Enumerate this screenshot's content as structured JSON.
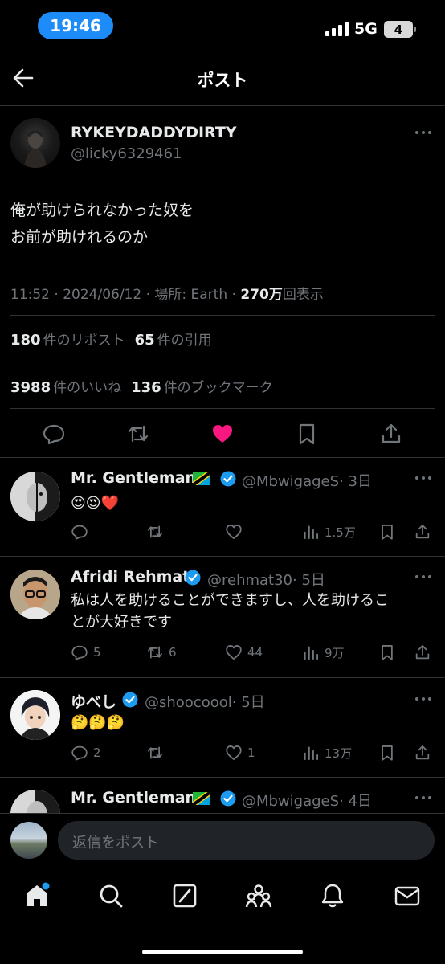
{
  "status_bar": {
    "time": "19:46",
    "network": "5G",
    "battery": "4"
  },
  "header": {
    "title": "ポスト"
  },
  "post": {
    "author_name": "RYKEYDADDYDIRTY",
    "author_handle": "@licky6329461",
    "text_line1": "俺が助けられなかった奴を",
    "text_line2": "お前が助けれるのか",
    "time_date": "11:52 · 2024/06/12 · 場所: Earth ·",
    "views_count": "270万",
    "views_label": "回表示",
    "reposts_count": "180",
    "reposts_label": "件のリポスト",
    "quotes_count": "65",
    "quotes_label": "件の引用",
    "likes_count": "3988",
    "likes_label": "件のいいね",
    "bookmarks_count": "136",
    "bookmarks_label": "件のブックマーク",
    "liked": true,
    "like_color": "#f91880"
  },
  "replies": [
    {
      "name": "Mr. Gentleman",
      "handle": "@MbwigageS",
      "age": "· 3日",
      "text": "😍😍❤️",
      "reply_count": "",
      "repost_count": "",
      "like_count": "",
      "view_count": "1.5万"
    },
    {
      "name": "Afridi Rehmat",
      "handle": "@rehmat30",
      "age": "· 5日",
      "text_line1": "私は人を助けることができますし、人を助けるこ",
      "text_line2": "とが大好きです",
      "reply_count": "5",
      "repost_count": "6",
      "like_count": "44",
      "view_count": "9万"
    },
    {
      "name": "ゆべし",
      "handle": "@shoocoool",
      "age": "· 5日",
      "text": "🤔🤔🤔",
      "reply_count": "2",
      "repost_count": "",
      "like_count": "1",
      "view_count": "13万"
    },
    {
      "name": "Mr. Gentleman",
      "handle": "@MbwigageS",
      "age": "· 4日"
    }
  ],
  "reply_bar": {
    "placeholder": "返信をポスト"
  },
  "colors": {
    "accent": "#1d9bf0",
    "verified": "#1d9bf0",
    "muted": "#71767b",
    "like": "#f91880"
  }
}
